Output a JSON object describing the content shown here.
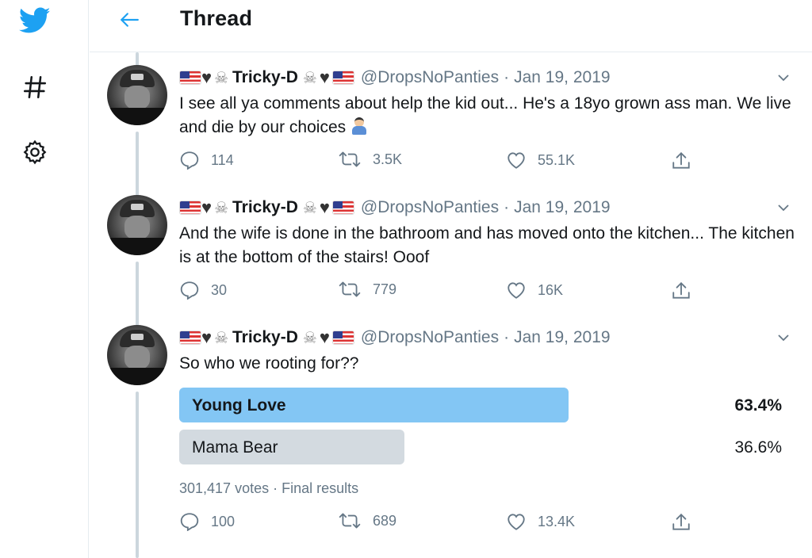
{
  "header": {
    "title": "Thread"
  },
  "colors": {
    "twitter_blue": "#1da1f2",
    "poll_winner": "#83c6f4",
    "poll_other": "#d3dae0",
    "secondary_text": "#657786"
  },
  "tweets": [
    {
      "display_name": "Tricky-D",
      "handle": "@DropsNoPanties",
      "date": "Jan 19, 2019",
      "text": "I see all ya comments about help the kid out... He's a 18yo grown ass man. We live and die by our choices",
      "trailing_emoji": "man-shrugging-emoji",
      "replies": "114",
      "retweets": "3.5K",
      "likes": "55.1K"
    },
    {
      "display_name": "Tricky-D",
      "handle": "@DropsNoPanties",
      "date": "Jan 19, 2019",
      "text": "And the wife is done in the bathroom and has moved onto the kitchen... The kitchen is at the bottom of the stairs!  Ooof",
      "replies": "30",
      "retweets": "779",
      "likes": "16K"
    },
    {
      "display_name": "Tricky-D",
      "handle": "@DropsNoPanties",
      "date": "Jan 19, 2019",
      "text": "So who we rooting for??",
      "poll": {
        "options": [
          {
            "label": "Young Love",
            "percent_text": "63.4%",
            "percent": 63.4,
            "winner": true
          },
          {
            "label": "Mama Bear",
            "percent_text": "36.6%",
            "percent": 36.6,
            "winner": false
          }
        ],
        "meta": "301,417 votes · Final results"
      },
      "replies": "100",
      "retweets": "689",
      "likes": "13.4K"
    }
  ]
}
